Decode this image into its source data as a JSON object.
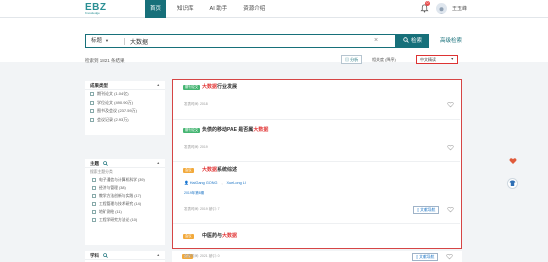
{
  "logo": {
    "main": "EBZ",
    "sub": "Knowledge"
  },
  "nav": {
    "items": [
      "首页",
      "知识库",
      "AI 助手",
      "资源介绍"
    ]
  },
  "notifications": {
    "count": "0"
  },
  "user": {
    "name": "王玉峰"
  },
  "search": {
    "field": "标题",
    "query": "大数据",
    "button": "检索",
    "advanced": "高级检索"
  },
  "toolbar": {
    "result_count": "检索到 1821 条结果",
    "analyze": "分析",
    "sort_label": "相关度 (降序)",
    "sort_value": "中文精读"
  },
  "filters": {
    "type": {
      "title": "成果类型",
      "items": [
        "期刊论文 (1.04亿)",
        "学位论文 (490.90万)",
        "图书及会议 (237.59万)",
        "会议记录 (2.93万)"
      ]
    },
    "subject": {
      "title": "主题",
      "search_placeholder": "搜索主题分类",
      "items": [
        "电子通信与计算机科学 (39)",
        "经济与管理 (38)",
        "教学方法创新与实践 (17)",
        "工程管理与技术研究 (14)",
        "地矿测绘 (11)",
        "工程学研究方法论 (10)"
      ]
    },
    "discipline": {
      "title": "学科"
    }
  },
  "results": [
    {
      "tag": "期刊论文",
      "tag_color": "green",
      "title_hl": "大数据",
      "title_rest": "行业发展",
      "meta": "发表时间: 2018"
    },
    {
      "tag": "期刊论文",
      "tag_color": "green",
      "title_pre": "负债的移动PAE 是否属",
      "title_hl": "大数据",
      "meta": "发表时间: 2019"
    },
    {
      "tag": "会议",
      "tag_color": "orange",
      "title_hl": "大数据",
      "title_rest": "系统综述",
      "authors": [
        "HaiGang GONG",
        "XueLong LI"
      ],
      "year": "2019年第8期",
      "meta": "发表时间: 2019  被引: 7",
      "cite": "文献导航"
    },
    {
      "tag": "会议",
      "tag_color": "orange",
      "title_pre": "中医药与",
      "title_hl": "大数据",
      "meta": ""
    }
  ],
  "below": {
    "tag": "会议",
    "meta": "发表时间: 2021  被引: 0",
    "cite": "文献导航"
  },
  "colors": {
    "brand": "#17707a",
    "highlight": "#e23b3b",
    "selection_border": "#d64545"
  }
}
